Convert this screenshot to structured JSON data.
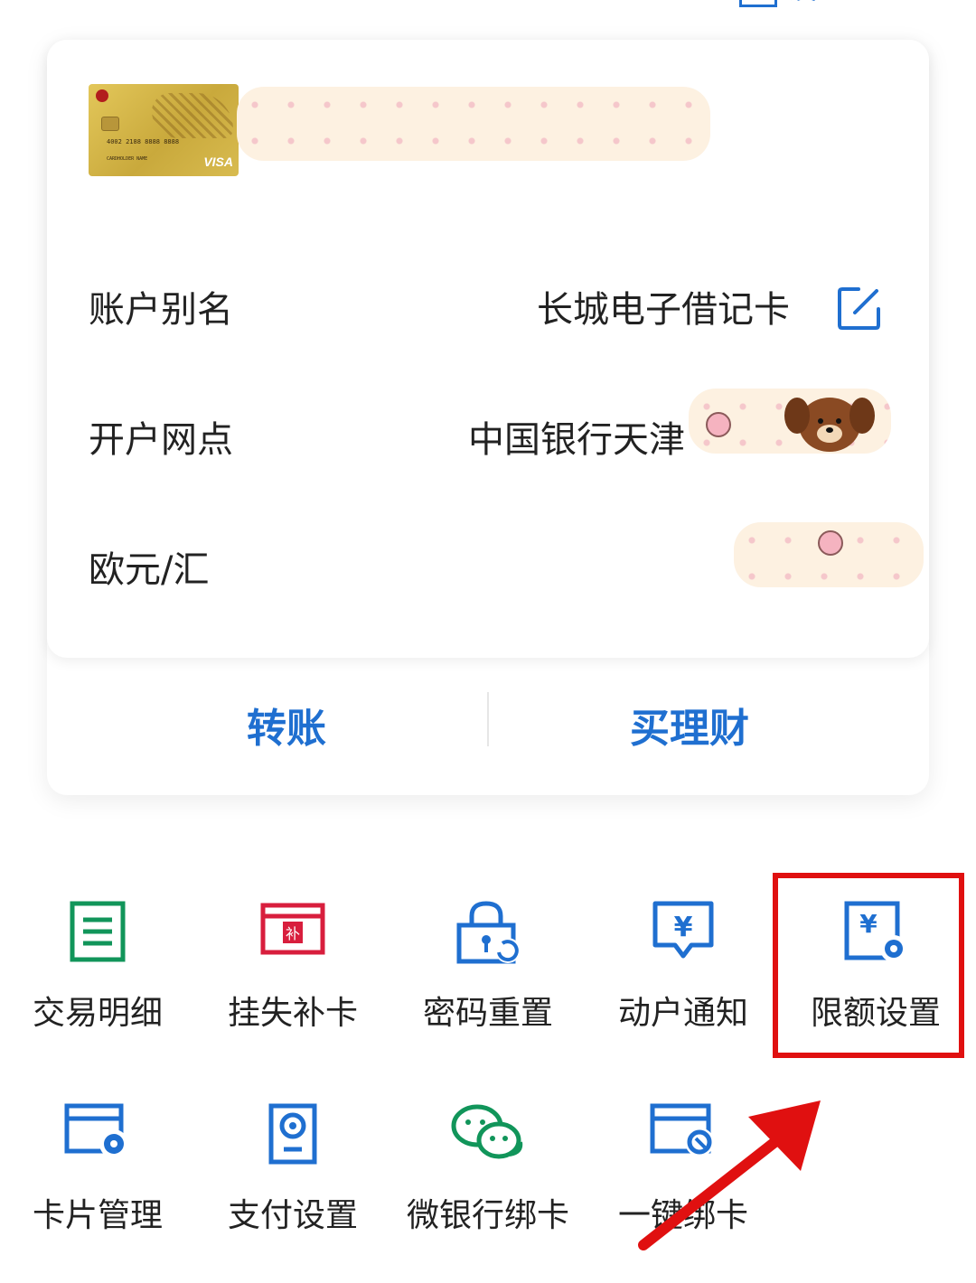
{
  "top_link": "设置",
  "account": {
    "rows": [
      {
        "label": "账户别名",
        "value": "长城电子借记卡"
      },
      {
        "label": "开户网点",
        "value": "中国银行天津"
      },
      {
        "label": "欧元/汇",
        "value": ""
      }
    ]
  },
  "actions": {
    "transfer": "转账",
    "wealth": "买理财"
  },
  "services": [
    {
      "label": "交易明细",
      "icon": "document-list-icon",
      "color": "#11955A"
    },
    {
      "label": "挂失补卡",
      "icon": "card-replace-icon",
      "color": "#D81E3D"
    },
    {
      "label": "密码重置",
      "icon": "lock-reset-icon",
      "color": "#1F6FD0"
    },
    {
      "label": "动户通知",
      "icon": "yuan-notice-icon",
      "color": "#1F6FD0"
    },
    {
      "label": "限额设置",
      "icon": "yuan-gear-icon",
      "color": "#1F6FD0"
    },
    {
      "label": "卡片管理",
      "icon": "card-gear-icon",
      "color": "#1F6FD0"
    },
    {
      "label": "支付设置",
      "icon": "phone-gear-icon",
      "color": "#1F6FD0"
    },
    {
      "label": "微银行绑卡",
      "icon": "wechat-icon",
      "color": "#11955A"
    },
    {
      "label": "一键绑卡",
      "icon": "card-click-icon",
      "color": "#1F6FD0"
    }
  ],
  "colors": {
    "accent": "#1F6FD0",
    "highlight": "#E01010"
  }
}
